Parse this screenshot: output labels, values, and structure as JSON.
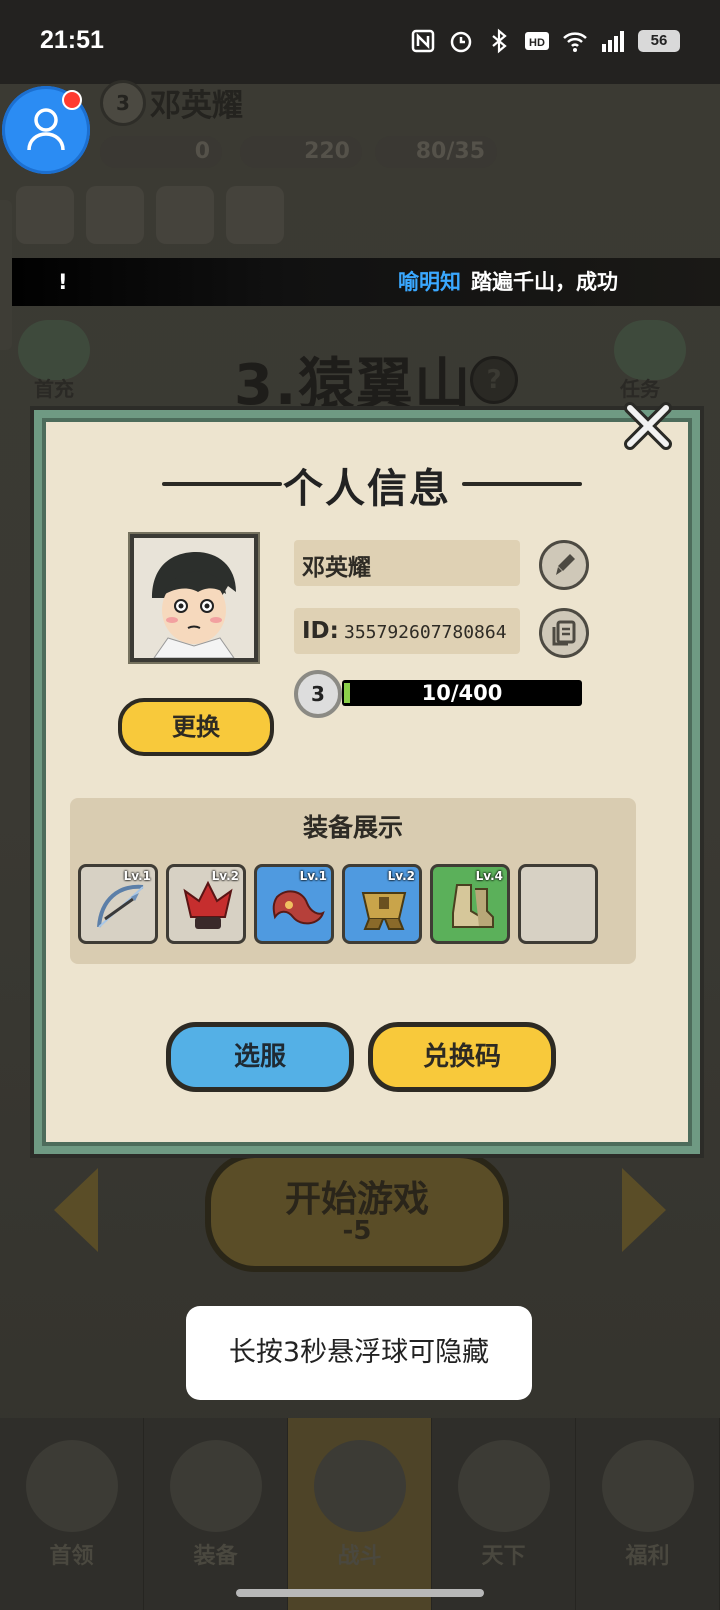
{
  "status_bar": {
    "time": "21:51",
    "battery": "56"
  },
  "player": {
    "name": "邓英耀",
    "level": "3",
    "res_coins": "0",
    "res_jade": "220",
    "res_peach": "80/35"
  },
  "ticker": {
    "left_fragment": "!",
    "name": "喻明知",
    "message": "踏遍千山，成功"
  },
  "map": {
    "title": "3.猿翼山",
    "help": "?",
    "first_charge": "首充",
    "tasks": "任务"
  },
  "modal": {
    "title": "个人信息",
    "name": "邓英耀",
    "id_label": "ID:",
    "id_value": "355792607780864",
    "level": "3",
    "xp_text": "10/400",
    "xp_fraction": 0.025,
    "change_label": "更换",
    "equip_title": "装备展示",
    "equipment": [
      {
        "lv": "Lv.1",
        "icon": "bow-icon",
        "rarity": "grey"
      },
      {
        "lv": "Lv.2",
        "icon": "red-helmet-icon",
        "rarity": "grey"
      },
      {
        "lv": "Lv.1",
        "icon": "sash-icon",
        "rarity": "blue"
      },
      {
        "lv": "Lv.2",
        "icon": "gold-armor-icon",
        "rarity": "blue"
      },
      {
        "lv": "Lv.4",
        "icon": "boots-icon",
        "rarity": "green"
      },
      {
        "lv": "",
        "icon": "",
        "rarity": "grey"
      }
    ],
    "server_label": "选服",
    "redeem_label": "兑换码"
  },
  "start": {
    "label": "开始游戏",
    "cost": "-5"
  },
  "nav": {
    "tabs": [
      "首领",
      "装备",
      "战斗",
      "天下",
      "福利"
    ]
  },
  "toast": {
    "text": "长按3秒悬浮球可隐藏"
  },
  "colors": {
    "modal_border": "#6f9a83",
    "primary_yellow": "#f8c93b",
    "primary_blue": "#54b0e6",
    "xp_fill": "#8cd04a"
  }
}
